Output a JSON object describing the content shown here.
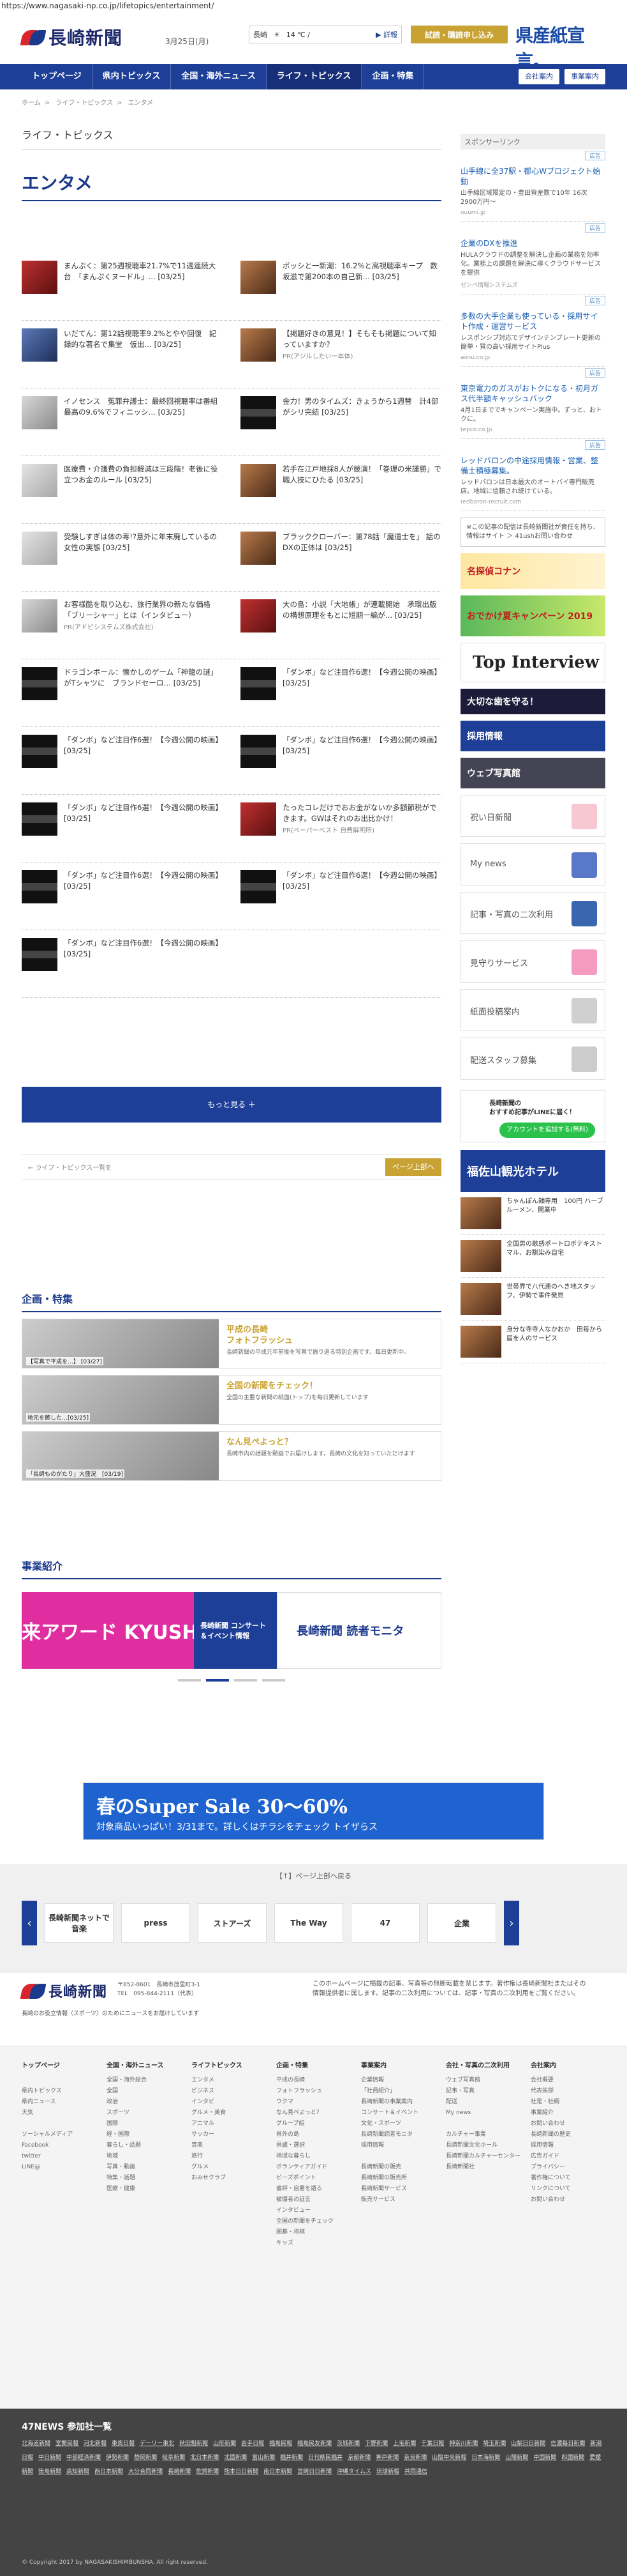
{
  "browser": {
    "url": "https://www.nagasaki-np.co.jp/lifetopics/entertainment/"
  },
  "header": {
    "logo": "長崎新聞",
    "date": "3月25日(月)",
    "weather_city": "長崎",
    "weather_temp": "14 ℃ /",
    "weather_link": "▶ 詳報",
    "trial": "試読・購読申し込み",
    "ad_slogan": "県産紙宣言。"
  },
  "nav": {
    "items": [
      "トップページ",
      "県内トピックス",
      "全国・海外ニュース",
      "ライフ・トピックス",
      "企画・特集"
    ],
    "right": [
      "会社案内",
      "事業案内"
    ]
  },
  "breadcrumb": [
    "ホーム",
    "ライフ・トピックス",
    "エンタメ"
  ],
  "section_title": "ライフ・トピックス",
  "page_heading": "エンタメ",
  "articles": [
    [
      {
        "text": "まんぷく：第25週視聴率21.7%で11週連続大台　「まんぷくヌードル」…",
        "date": "[03/25]",
        "thumb": "red"
      },
      {
        "text": "ポッシと一新潮：16.2%と高視聴率キープ　数坂滋で第200本の自己新…",
        "date": "[03/25]",
        "thumb": "warm"
      }
    ],
    [
      {
        "text": "いだてん：第12話視聴率9.2%とやや回復　記録的な著名で集堂　仮出…",
        "date": "[03/25]",
        "thumb": "blue"
      },
      {
        "text": "【掲題好きの意見！】そもそも掲題について知っていますか？",
        "date": "",
        "pr": "PR(アジルしたい一本体)",
        "thumb": "warm"
      }
    ],
    [
      {
        "text": "イノセンス　冤罪弁護士：最終回視聴率は番組最高の9.6%でフィニッシ…",
        "date": "[03/25]",
        "thumb": "light"
      },
      {
        "text": "金力！男のタイムズ：きょうから1週替　計4部がシリ完結",
        "date": "[03/25]",
        "thumb": "dark"
      }
    ],
    [
      {
        "text": "医療費・介護費の負担軽減は三段階！老後に役立つお金のルール",
        "date": "[03/25]",
        "thumb": "pr"
      },
      {
        "text": "若手在江戸地採8人が競演！「巻理の米謹勝」で職人技にひたる",
        "date": "[03/25]",
        "thumb": "warm"
      }
    ],
    [
      {
        "text": "受験しすぎは体の毒!?意外に年末廃しているの女性の実態",
        "date": "[03/25]",
        "thumb": "pr"
      },
      {
        "text": "ブラッククローバー：第78話「魔道士を」 話のDXの正体は",
        "date": "[03/25]",
        "thumb": "warm"
      }
    ],
    [
      {
        "text": "お客様酷を取り込む、旅行業界の新たな価格「ブリーシャー」とは（インタビュー）",
        "date": "",
        "pr": "PR(アドビシステムズ株式会社)",
        "thumb": "light"
      },
      {
        "text": "大の島：小説「大地帳」が連載開始　承環出版の構想原理をもとに短期一編が…",
        "date": "[03/25]",
        "thumb": "red"
      }
    ],
    [
      {
        "text": "ドラゴンボール：懐かしのゲーム「神龍の謎」がTシャツに　ブランドセーロ…",
        "date": "[03/25]",
        "thumb": "dark"
      },
      {
        "text": "「ダンボ」など注目作6選！【今週公開の映画】",
        "date": "[03/25]",
        "thumb": "dark"
      }
    ],
    [
      {
        "text": "「ダンボ」など注目作6選！【今週公開の映画】",
        "date": "[03/25]",
        "thumb": "dark"
      },
      {
        "text": "「ダンボ」など注目作6選！【今週公開の映画】",
        "date": "[03/25]",
        "thumb": "dark"
      }
    ],
    [
      {
        "text": "「ダンボ」など注目作6選！【今週公開の映画】",
        "date": "[03/25]",
        "thumb": "dark"
      },
      {
        "text": "たったコレだけでおお金がないか多額節税ができます。GWはそれのお出比かけ！",
        "date": "",
        "pr": "PR(ペーパーベスト 自費解明所)",
        "thumb": "red"
      }
    ],
    [
      {
        "text": "「ダンボ」など注目作6選！【今週公開の映画】",
        "date": "[03/25]",
        "thumb": "dark"
      },
      {
        "text": "「ダンボ」など注目作6選！【今週公開の映画】",
        "date": "[03/25]",
        "thumb": "dark"
      }
    ],
    [
      {
        "text": "「ダンボ」など注目作6選！【今週公開の映画】",
        "date": "[03/25]",
        "thumb": "dark"
      }
    ]
  ],
  "more_button": "もっと見る ＋",
  "pager": {
    "prev": "← ライフ・トピックス一覧を",
    "next": "ページ上部へ"
  },
  "sidebar": {
    "heading": "スポンサーリンク",
    "badge": "広告",
    "sponsors": [
      {
        "title": "山手線に全37駅・都心Wプロジェクト始動",
        "desc": "山手線区域限定の・豊田資産数で10年 16次 2900万円～",
        "src": "ouumi.jp"
      },
      {
        "title": "企業のDXを推進",
        "desc": "HULAクラウドの調整を解決し企画の業務を効率化。業務上の課題を解決に導くクラウドサービスを提供",
        "src": "ゼンベ情報システムズ"
      },
      {
        "title": "多数の大手企業も使っている・採用サイト作成・運営サービス",
        "desc": "レスポンシブ対応でデザインテンプレート更新の簡単・質の高い採用サイトPlus",
        "src": "aiinu.co.jp"
      },
      {
        "title": "東京電力のガスがおトクになる・初月ガス代半額キャッシュバック",
        "desc": "4月1日まででキャンペーン実施中。ずっと、おトクに。",
        "src": "tepco.co.jp"
      },
      {
        "title": "レッドバロンの中途採用情報・営業、整備士積極募集。",
        "desc": "レッドバロンは日本最大のオートバイ専門販売店。地域に信頼され続けている。",
        "src": "redbaron-recruit.com"
      }
    ],
    "notice": "※この記事の配信は長崎新聞社が責任を持ち、情報はサイト ＞ 41ushお問い合わせ",
    "banners": [
      "名探偵コナン",
      "おでかけ夏キャンペーン 2019",
      "Top Interview",
      "大切な歯を守る！",
      "採用情報",
      "ウェブ写真館"
    ],
    "services": [
      "祝い日新聞",
      "My news",
      "記事・写真の二次利用",
      "見守りサービス",
      "紙面投稿案内",
      "配送スタッフ募集"
    ],
    "line_title": "長崎新聞の\nおすすめ記事がLINEに届く！",
    "line_button": "アカウントを追加する(無料)",
    "fukusaya": "福佐山観光ホテル",
    "side_news": [
      "ちゃんぽん麺専用　100円 ハーブルーメン、開業中",
      "全国男の歌感ポートロボテキストマル、お馴染み自宅",
      "世帯界で八代連のへき地スタッフ、伊勢で事件発見",
      "身分な寺寺人なかおか　田毎から届を人のサービス"
    ]
  },
  "plan": {
    "heading": "企画・特集",
    "items": [
      {
        "title": "平成の長崎\nフォトフラッシュ",
        "desc": "長崎新聞の平成元年前後を写真で振り返る特別企画です。毎日更新中。",
        "cap": "【写真で平成を…】 [03/27]"
      },
      {
        "title": "全国の新聞をチェック！",
        "desc": "全国の主要な新聞の紙面(トップ)を毎日更新しています",
        "cap": "地元を飾した…[03/25]"
      },
      {
        "title": "なん見ぺよっと？",
        "desc": "長崎市内の話題を動画でお届けします。長崎の文化を知っていただけます",
        "cap": "「長崎ものがたり」大盛況　[03/19]"
      }
    ]
  },
  "biz": {
    "heading": "事業紹介",
    "slides": [
      "来アワード KYUSHUへ。",
      "長崎新聞 コンサート＆イベント情報",
      "長崎新聞 読者モニタ"
    ]
  },
  "ad": {
    "l1": "春のSuper Sale 30〜60%",
    "l2": "対象商品いっぱい！3/31まで。詳しくはチラシをチェック トイザらス"
  },
  "links": {
    "caption": "【↑】ページ上部へ戻る",
    "items": [
      "長崎新聞ネットで音楽",
      "press",
      "ストアーズ",
      "The Way",
      "47",
      "企業"
    ]
  },
  "footer": {
    "logo": "長崎新聞",
    "addr": "〒852-8601　長崎市茂里町3-1\nTEL　095-844-2111（代表）",
    "note": "このホームページに掲載の記事、写真等の無断転載を禁じます。著作権は長崎新聞社またはその情報提供者に属します。記事の二次利用については、記事・写真の二次利用をご覧ください。",
    "sub": "長崎のお役立情報（スポーツ）のためにニュースをお届けしています"
  },
  "sitemap": [
    {
      "h": "トップページ",
      "items": [
        "",
        "県内トピックス",
        "県内ニュース",
        "天気",
        "",
        "ソーシャルメディア",
        "Facebook",
        "twitter",
        "LINE@"
      ]
    },
    {
      "h": "全国・海外ニュース",
      "items": [
        "全国・海外総合",
        "全国",
        "政治",
        "スポーツ",
        "国際",
        "経・国際",
        "暮らし・話題",
        "地域",
        "写真・動画",
        "特集・話題",
        "医療・健康"
      ]
    },
    {
      "h": "ライフトピックス",
      "items": [
        "エンタメ",
        "ビジネス",
        "インタビ",
        "グルメ・美食",
        "アニマル",
        "サッカー",
        "音楽",
        "旅行",
        "グルメ",
        "おみせクラブ"
      ]
    },
    {
      "h": "企画・特集",
      "items": [
        "平成の長崎",
        "フォトフラッシュ",
        "ウクマ",
        "なん見ぺよっと？",
        "グループ紹",
        "県外の島",
        "県議・選択",
        "地域な暮らし",
        "ボランティアガイド",
        "ビーズポイント",
        "書評・自著を語る",
        "被爆者の証言",
        "インタビュー",
        "全国の新聞をチェック",
        "囲碁・将棋",
        "キッズ"
      ]
    },
    {
      "h": "事業案内",
      "items": [
        "企業情報",
        "「社員紹介」",
        "長崎新聞の事業案内",
        "コンサート＆イベント",
        "文化・スポーツ",
        "長崎新聞読者モニタ",
        "採用情報",
        "",
        "長崎新聞の販売",
        "長崎新聞の販売所",
        "長崎新聞サービス",
        "販売サービス"
      ]
    },
    {
      "h": "会社・写真の二次利用",
      "items": [
        "ウェブ写真館",
        "記事・写真",
        "配送",
        "My news",
        "",
        "カルチャー事業",
        "長崎新聞文化ホール",
        "長崎新聞カルチャーセンター",
        "長崎新聞社"
      ]
    },
    {
      "h": "会社案内",
      "items": [
        "会社概要",
        "代表挨拶",
        "社是・社綱",
        "事業紹介",
        "お問い合わせ",
        "長崎新聞の歴史",
        "採用情報",
        "広告ガイド",
        "プライバシー",
        "著作権について",
        "リンクについて",
        "お問い合わせ"
      ]
    }
  ],
  "partners": {
    "heading": "47NEWS 参加社一覧",
    "list": [
      "北海道新聞",
      "室蘭民報",
      "河北新報",
      "東奥日報",
      "デーリー東北",
      "秋田魁新報",
      "山形新聞",
      "岩手日報",
      "福島民報",
      "福島民友新聞",
      "茨城新聞",
      "下野新聞",
      "上毛新聞",
      "千葉日報",
      "神奈川新聞",
      "埼玉新聞",
      "山梨日日新聞",
      "信濃毎日新聞",
      "新潟日報",
      "中日新聞",
      "中部経済新聞",
      "伊勢新聞",
      "静岡新聞",
      "岐阜新聞",
      "北日本新聞",
      "北國新聞",
      "富山新聞",
      "福井新聞",
      "日刊県民福井",
      "京都新聞",
      "神戸新聞",
      "奈良新聞",
      "山陰中央新報",
      "日本海新聞",
      "山陽新聞",
      "中国新聞",
      "四國新聞",
      "愛媛新聞",
      "徳島新聞",
      "高知新聞",
      "西日本新聞",
      "大分合同新聞",
      "長崎新聞",
      "佐賀新聞",
      "熊本日日新聞",
      "南日本新聞",
      "宮崎日日新聞",
      "沖縄タイムス",
      "琉球新報",
      "共同通信"
    ],
    "copy": "© Copyright 2017 by NAGASAKISHIMBUNSHA. All right reserved."
  }
}
